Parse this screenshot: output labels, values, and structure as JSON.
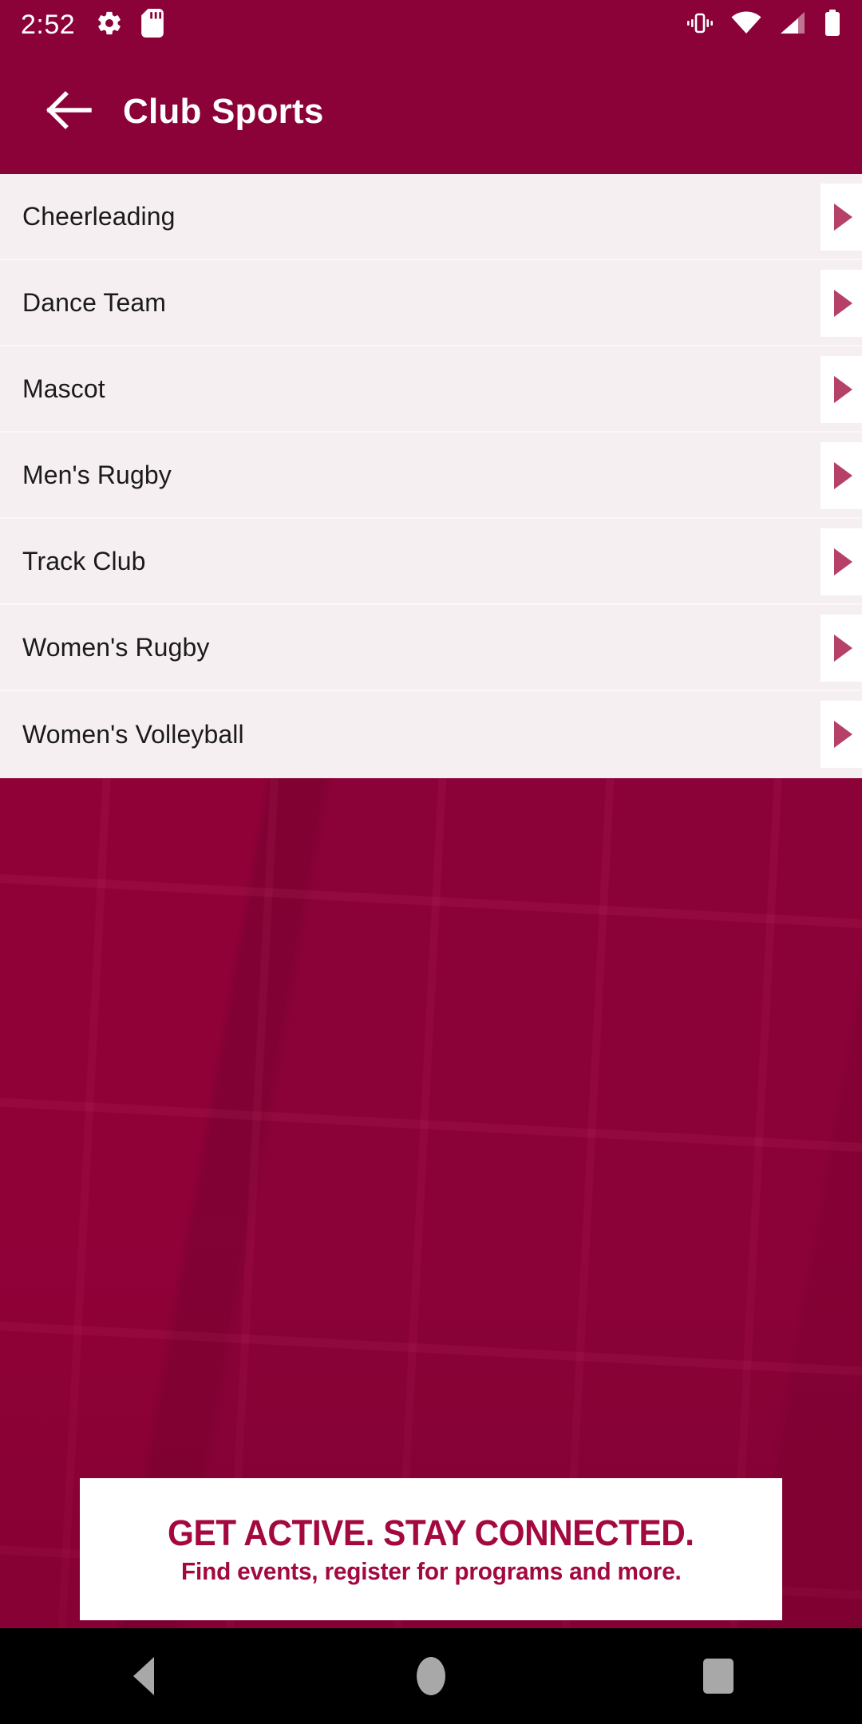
{
  "status_bar": {
    "clock": "2:52",
    "left_icons": [
      "settings-gear-icon",
      "sd-card-icon"
    ],
    "right_icons": [
      "vibrate-icon",
      "wifi-icon",
      "cellular-signal-icon",
      "battery-icon"
    ],
    "background_color": "#8b0238",
    "foreground_color": "#ffffff"
  },
  "app_bar": {
    "back_icon": "arrow-left-icon",
    "title": "Club Sports",
    "background_color": "#8b0238",
    "title_color": "#ffffff"
  },
  "list": {
    "background_color": "#f6eff1",
    "text_color": "#1b1b1b",
    "chevron_color": "#b54169",
    "chevron_block_color": "#ffffff",
    "chevron_icon": "triangle-right-icon",
    "items": [
      {
        "label": "Cheerleading"
      },
      {
        "label": "Dance Team"
      },
      {
        "label": "Mascot"
      },
      {
        "label": "Men's Rugby"
      },
      {
        "label": "Track Club"
      },
      {
        "label": "Women's Rugby"
      },
      {
        "label": "Women's Volleyball"
      }
    ]
  },
  "background_photo": {
    "description": "building-facade-photo",
    "tint_color": "#8b0238"
  },
  "promo_banner": {
    "headline": "GET ACTIVE.  STAY CONNECTED.",
    "subline": "Find events, register for programs and more.",
    "text_color": "#a3083f",
    "background_color": "#ffffff"
  },
  "nav_bar": {
    "background_color": "#000000",
    "icon_color": "#a8a8a8",
    "buttons": [
      {
        "name": "back-triangle-icon"
      },
      {
        "name": "home-circle-icon"
      },
      {
        "name": "recents-square-icon"
      }
    ]
  }
}
